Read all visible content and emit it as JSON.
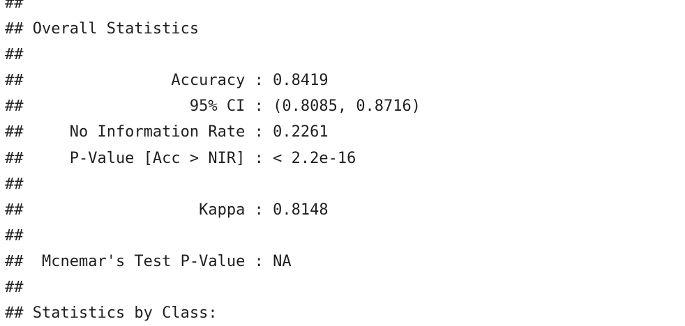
{
  "console_output": {
    "lines": [
      "##",
      "## Overall Statistics",
      "##",
      "##                Accuracy : 0.8419",
      "##                  95% CI : (0.8085, 0.8716)",
      "##     No Information Rate : 0.2261",
      "##     P-Value [Acc > NIR] : < 2.2e-16",
      "##",
      "##                   Kappa : 0.8148",
      "##",
      "##  Mcnemar's Test P-Value : NA",
      "##",
      "## Statistics by Class:"
    ]
  }
}
